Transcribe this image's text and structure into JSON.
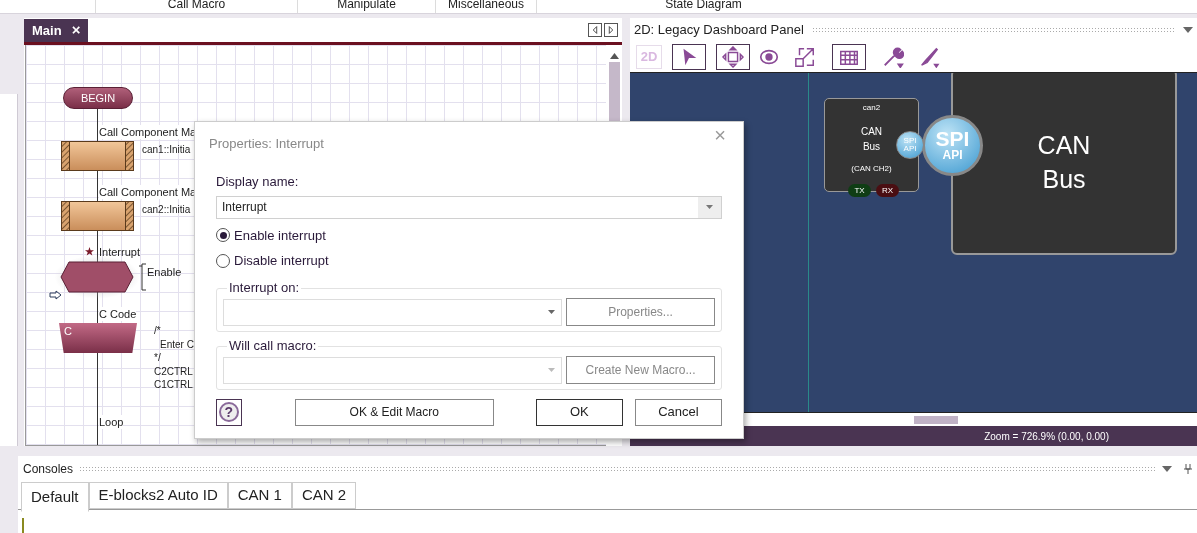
{
  "ribbon_groups": [
    "Call Macro",
    "Manipulate",
    "Miscellaneous",
    "State Diagram"
  ],
  "editor": {
    "tabs": [
      {
        "label": "Main",
        "close": "×",
        "selected": true
      }
    ],
    "flowchart": [
      {
        "kind": "terminal",
        "label": "BEGIN"
      },
      {
        "kind": "call",
        "caption": "Call Component Ma",
        "detail": "can1::Initia"
      },
      {
        "kind": "call",
        "caption": "Call Component Ma",
        "detail": "can2::Initia"
      },
      {
        "kind": "interrupt",
        "caption": "Interrupt",
        "note": "Enable"
      },
      {
        "kind": "code",
        "caption": "C Code",
        "glyph": "C",
        "lines": [
          "/*",
          "Enter C",
          "*/",
          "C2CTRL",
          "C1CTRL"
        ]
      },
      {
        "kind": "loop",
        "caption": "Loop"
      }
    ]
  },
  "panel": {
    "title": "2D: Legacy Dashboard Panel",
    "mode_button": {
      "label": "2D",
      "disabled": true
    },
    "component": {
      "name": "can2",
      "title": [
        "CAN",
        "Bus"
      ],
      "channel": "(CAN CH2)",
      "pins": [
        {
          "label": "TX",
          "color": "#0f3d14"
        },
        {
          "label": "RX",
          "color": "#4a0e12"
        }
      ]
    },
    "api_small": [
      "SPI",
      "API"
    ],
    "api_large": [
      "SPI",
      "API"
    ],
    "bus_block": [
      "CAN",
      "Bus"
    ],
    "status": "Zoom = 726.9% (0.00, 0.00)"
  },
  "dialog": {
    "title": "Properties: Interrupt",
    "close": "×",
    "help": "?",
    "display_name_label": "Display name:",
    "display_name": "Interrupt",
    "options": [
      {
        "label": "Enable interrupt",
        "selected": true
      },
      {
        "label": "Disable interrupt",
        "selected": false
      }
    ],
    "groups": [
      {
        "label": "Interrupt on:",
        "button": "Properties..."
      },
      {
        "label": "Will call macro:",
        "button": "Create New Macro..."
      }
    ],
    "buttons": [
      "OK & Edit Macro",
      "OK",
      "Cancel"
    ]
  },
  "consoles": {
    "title": "Consoles",
    "tabs": [
      {
        "label": "Default",
        "selected": true
      },
      {
        "label": "E-blocks2 Auto ID",
        "selected": false
      },
      {
        "label": "CAN 1",
        "selected": false
      },
      {
        "label": "CAN 2",
        "selected": false
      }
    ]
  }
}
